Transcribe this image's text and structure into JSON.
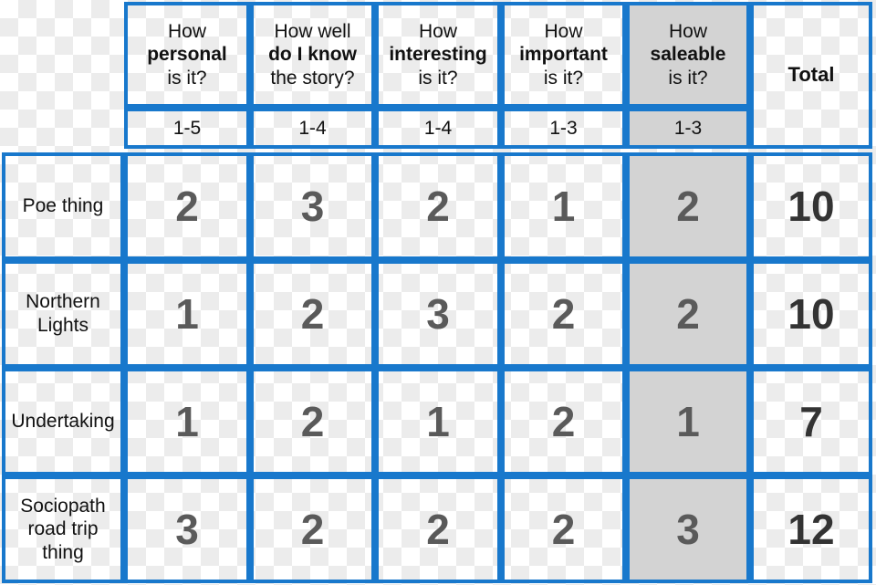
{
  "table": {
    "columns": [
      {
        "id": "personal",
        "header_lines": [
          "How",
          "personal",
          "is it?"
        ],
        "keyword_index": 1,
        "scale": "1-5",
        "shaded": false
      },
      {
        "id": "know-story",
        "header_lines": [
          "How well",
          "do I know",
          "the story?"
        ],
        "keyword_index": 1,
        "scale": "1-4",
        "shaded": false
      },
      {
        "id": "interesting",
        "header_lines": [
          "How",
          "interesting",
          "is it?"
        ],
        "keyword_index": 1,
        "scale": "1-4",
        "shaded": false
      },
      {
        "id": "important",
        "header_lines": [
          "How",
          "important",
          "is it?"
        ],
        "keyword_index": 1,
        "scale": "1-3",
        "shaded": false
      },
      {
        "id": "saleable",
        "header_lines": [
          "How",
          "saleable",
          "is it?"
        ],
        "keyword_index": 1,
        "scale": "1-3",
        "shaded": true
      }
    ],
    "total_header": "Total",
    "rows": [
      {
        "label_lines": [
          "Poe thing"
        ],
        "scores": [
          "2",
          "3",
          "2",
          "1",
          "2"
        ],
        "total": "10"
      },
      {
        "label_lines": [
          "Northern",
          "Lights"
        ],
        "scores": [
          "1",
          "2",
          "3",
          "2",
          "2"
        ],
        "total": "10"
      },
      {
        "label_lines": [
          "Undertaking"
        ],
        "scores": [
          "1",
          "2",
          "1",
          "2",
          "1"
        ],
        "total": "7"
      },
      {
        "label_lines": [
          "Sociopath",
          "road trip",
          "thing"
        ],
        "scores": [
          "3",
          "2",
          "2",
          "2",
          "3"
        ],
        "total": "12"
      }
    ]
  },
  "colors": {
    "grid_blue": "#1878cc",
    "shaded_column": "#d3d3d3",
    "score_gray": "#5a5a5a",
    "total_dark": "#333333",
    "text_black": "#111111"
  }
}
